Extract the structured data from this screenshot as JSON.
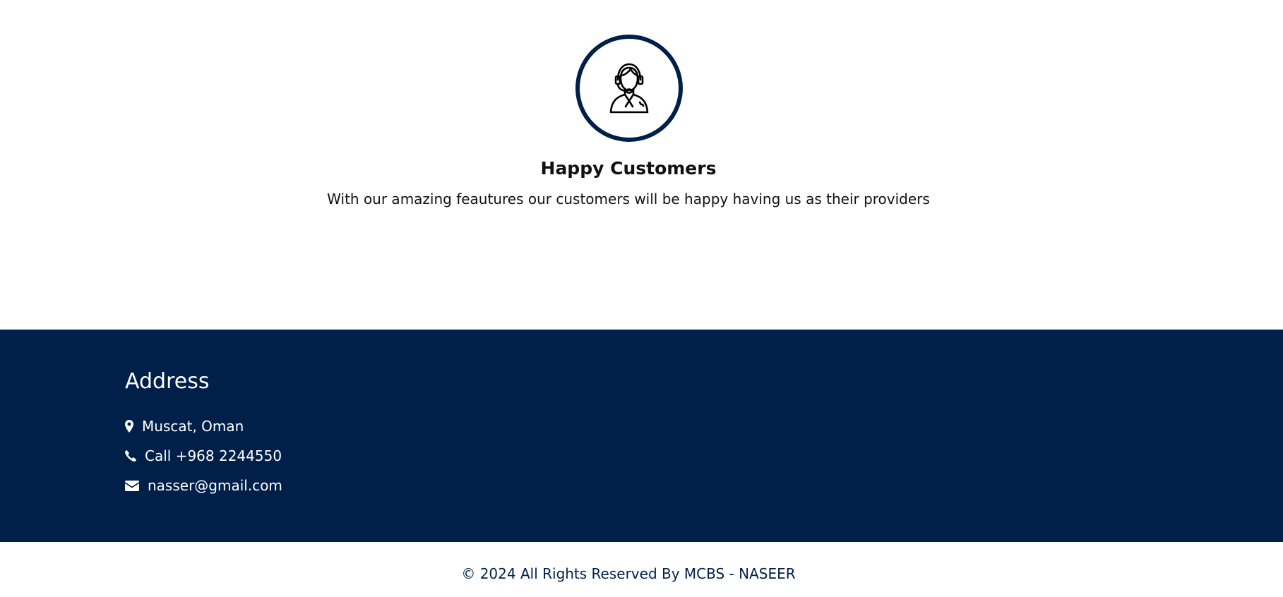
{
  "feature": {
    "icon": "customer-support-agent-icon",
    "title": "Happy Customers",
    "description": "With our amazing feautures our customers will be happy having us as their providers"
  },
  "footer": {
    "heading": "Address",
    "background_color": "#00204a",
    "contacts": [
      {
        "icon": "map-marker-icon",
        "text": "Muscat, Oman"
      },
      {
        "icon": "phone-icon",
        "text": "Call +968 2244550"
      },
      {
        "icon": "envelope-icon",
        "text": "nasser@gmail.com"
      }
    ]
  },
  "copyright": {
    "text": "© 2024 All Rights Reserved By MCBS - NASEER",
    "color": "#00204a"
  }
}
